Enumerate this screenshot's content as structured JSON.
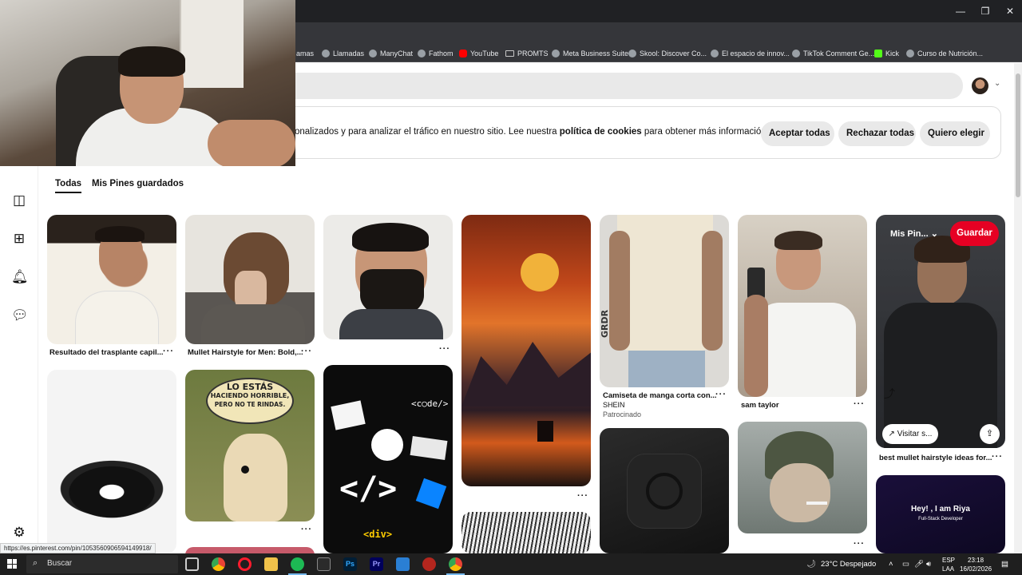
{
  "browser": {
    "bookmarks": [
      {
        "label": "amas",
        "icon": "none"
      },
      {
        "label": "Llamadas",
        "icon": "globe-icon"
      },
      {
        "label": "ManyChat",
        "icon": "globe-icon"
      },
      {
        "label": "Fathom",
        "icon": "globe-icon"
      },
      {
        "label": "YouTube",
        "icon": "youtube-icon"
      },
      {
        "label": "PROMTS",
        "icon": "folder-icon"
      },
      {
        "label": "Meta Business Suite",
        "icon": "globe-icon"
      },
      {
        "label": "Skool: Discover Co...",
        "icon": "globe-icon"
      },
      {
        "label": "El espacio de innov...",
        "icon": "globe-icon"
      },
      {
        "label": "TikTok Comment Ge...",
        "icon": "globe-icon"
      },
      {
        "label": "Kick",
        "icon": "kick-icon"
      },
      {
        "label": "Curso de Nutrición...",
        "icon": "globe-icon"
      }
    ],
    "status_url": "https://es.pinterest.com/pin/1053560906594149918/"
  },
  "cookie_banner": {
    "text_before": "onalizados y para analizar el tráfico en nuestro sitio. Lee nuestra ",
    "link": "política de cookies",
    "text_after": " para obtener más información.",
    "accept": "Aceptar todas",
    "reject": "Rechazar todas",
    "choose": "Quiero elegir"
  },
  "tabs": {
    "all": "Todas",
    "saved": "Mis Pines guardados"
  },
  "pins": {
    "p1_title": "Resultado del trasplante capil...",
    "p2_title": "Mullet Hairstyle for Men: Bold,...",
    "p3_title": "",
    "p5_title": "Camiseta de manga corta con...",
    "p5_brand": "SHEIN",
    "p5_sponsored": "Patrocinado",
    "p6_title": "sam taylor",
    "p7_title": "best mullet hairstyle ideas for...",
    "p7_board": "Mis Pin...",
    "p7_save": "Guardar",
    "p7_visit": "Visitar s...",
    "sign_line1": "LO ESTÁS",
    "sign_line2": "HACIENDO HORRIBLE,",
    "sign_line3": "PERO NO TE RINDAS.",
    "coder_tag": "<c○de/>",
    "coder_code": "</>",
    "coder_html": "<div>",
    "tshirt_brand": "GRDR",
    "dev_hey": "Hey! , I am Riya",
    "dev_role": "Full-Stack Developer"
  },
  "taskbar": {
    "search": "Buscar",
    "weather": "23°C  Despejado",
    "lang1": "ESP",
    "lang2": "LAA",
    "time": "23:18",
    "date": "16/02/2026"
  }
}
